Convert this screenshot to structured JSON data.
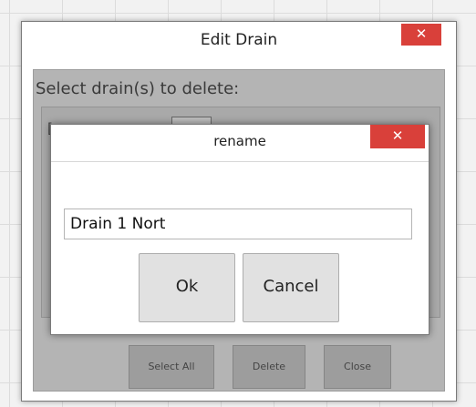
{
  "outer_dialog": {
    "title": "Edit Drain",
    "close_glyph": "✕",
    "prompt": "Select drain(s) to delete:",
    "list_first_item": "[",
    "buttons": {
      "select_all": "Select All",
      "delete": "Delete",
      "close": "Close"
    }
  },
  "rename_dialog": {
    "title": "rename",
    "close_glyph": "✕",
    "name_value": "Drain 1 Nort",
    "ok_label": "Ok",
    "cancel_label": "Cancel"
  },
  "colors": {
    "close_button": "#d9403a"
  }
}
